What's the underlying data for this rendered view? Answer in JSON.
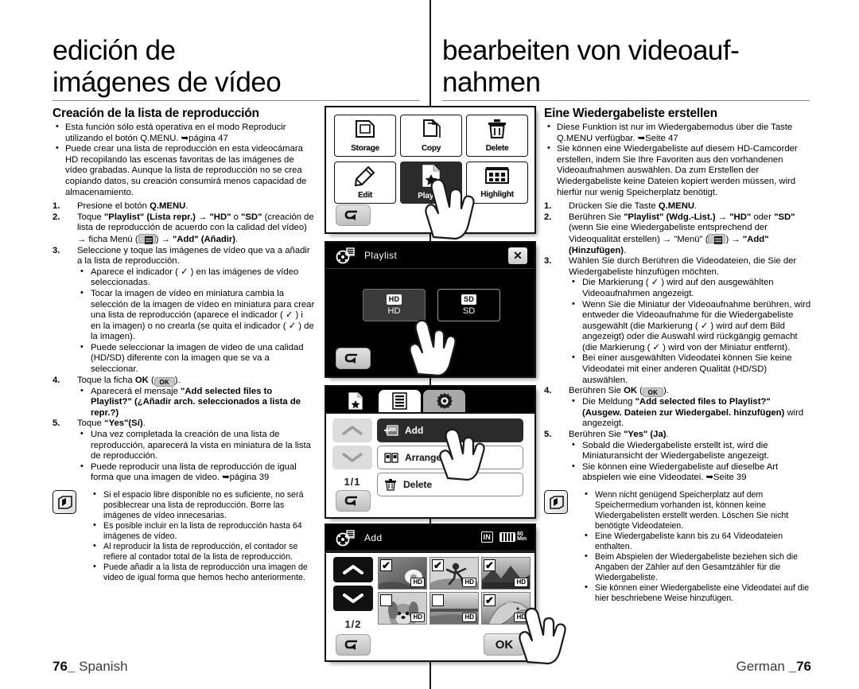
{
  "page": {
    "left_lang_footer": "Spanish",
    "right_lang_footer": "German",
    "page_number": "76",
    "footer_left_num": "76_",
    "footer_right_num": "_76"
  },
  "spanish": {
    "chapter_title": "edición de imágenes de vídeo",
    "section_heading": "Creación de la lista de reproducción",
    "intro_bullets": [
      "Esta función sólo está operativa en el modo Reproducir utilizando el botón Q.MENU. ➥página 47",
      "Puede crear una lista de reproducción en esta videocámara HD recopilando las escenas favoritas de las imágenes de vídeo grabadas. Aunque la lista de reproducción no se crea copiando datos, su creación consumirá menos capacidad de almacenamiento."
    ],
    "steps": [
      {
        "num": "1.",
        "text_html": "Presione el botón <b>Q.MENU</b>.",
        "sub": []
      },
      {
        "num": "2.",
        "text_html": "Toque <b>\"Playlist\" (Lista repr.)</b> → <b>\"HD\"</b> o <b>\"SD\"</b> (creación de lista de reproducción de acuerdo con la calidad del vídeo) → ficha Menú (<span class=\"inline-menu-icon\" data-name=\"menu-tab-icon\"></span>) → <b>\"Add\" (Añadir)</b>.",
        "sub": []
      },
      {
        "num": "3.",
        "text_html": "Seleccione y toque las imágenes de vídeo que va a añadir a la lista de reproducción.",
        "sub": [
          "Aparece el indicador ( ✓ ) en las imágenes de vídeo seleccionadas.",
          "Tocar la imagen de vídeo en miniatura cambia la selección de la imagen de vídeo en miniatura para crear una lista de reproducción (aparece el indicador ( ✓ ) i en la imagen) o no crearla (se quita el indicador ( ✓ ) de la imagen).",
          "Puede seleccionar la imagen de video de una calidad (HD/SD) diferente con la imagen que se va a seleccionar."
        ]
      },
      {
        "num": "4.",
        "text_html": "Toque la ficha <b>OK</b> (<span class=\"inline-ok-icon\" data-name=\"ok-tab-icon\">OK</span>).",
        "sub": [
          "Aparecerá el mensaje <b>\"Add selected files to Playlist?\" (¿Añadir arch. seleccionados a lista de repr.?)</b>"
        ]
      },
      {
        "num": "5.",
        "text_html": "Toque <b>“Yes\"(Sí)</b>.",
        "sub": [
          "Una vez completada la creación de una lista de reproducción, aparecerá la vista en miniatura de la lista de reproducción.",
          "Puede reproducir una lista de reproducción de igual forma que una imagen de video. ➥página 39"
        ]
      }
    ],
    "note_bullets": [
      "Si el espacio libre disponible no es suficiente, no será posiblecrear una lista de reproducción. Borre las imágenes de vídeo innecesarias.",
      "Es posible incluir en la lista de reproducción hasta 64 imágenes de vídeo.",
      "Al reproducir la lista de reproducción, el contador se refiere al contador total de la lista de reproducción.",
      "Puede añadir a la lista de reproducción una imagen de video de igual forma que hemos hecho anteriormente."
    ]
  },
  "german": {
    "chapter_title": "bearbeiten von videoauf-nahmen",
    "section_heading": "Eine Wiedergabeliste erstellen",
    "intro_bullets": [
      "Diese Funktion ist nur im Wiedergabemodus über die Taste Q.MENU verfügbar. ➥Seite 47",
      "Sie können eine Wiedergabeliste auf diesem HD-Camcorder erstellen, indem Sie Ihre Favoriten aus den vorhandenen Videoaufnahmen auswählen. Da zum Erstellen der Wiedergabeliste keine Dateien kopiert werden müssen, wird hierfür nur wenig Speicherplatz benötigt."
    ],
    "steps": [
      {
        "num": "1.",
        "text_html": "Drücken Sie die Taste <b>Q.MENU</b>.",
        "sub": []
      },
      {
        "num": "2.",
        "text_html": "Berühren Sie <b>\"Playlist\" (Wdg.-List.)</b> → <b>\"HD\"</b> oder <b>\"SD\"</b> (wenn Sie eine Wiedergabeliste entsprechend der Videoqualität erstellen) → \"Menü\" (<span class=\"inline-menu-icon\" data-name=\"menu-tab-icon\"></span>) → <b>\"Add\" (Hinzufügen)</b>.",
        "sub": []
      },
      {
        "num": "3.",
        "text_html": "Wählen Sie durch Berühren die Videodateien, die Sie der Wiedergabeliste hinzufügen möchten.",
        "sub": [
          "Die Markierung ( ✓ ) wird auf den ausgewählten Videoaufnahmen angezeigt.",
          "Wenn Sie die Miniatur der Videoaufnahme berühren, wird entweder die Videoaufnahme für die Wiedergabeliste ausgewählt (die Markierung ( ✓ ) wird auf dem Bild angezeigt) oder die Auswahl wird rückgängig gemacht (die Markierung ( ✓ ) wird von der Miniatur entfernt).",
          "Bei einer ausgewählten Videodatei können Sie keine Videodatei mit einer anderen Qualität (HD/SD) auswählen."
        ]
      },
      {
        "num": "4.",
        "text_html": "Berühren Sie <b>OK</b> (<span class=\"inline-ok-icon\" data-name=\"ok-tab-icon\">OK</span>).",
        "sub": [
          "Die Meldung <b>\"Add selected files to Playlist?\" (Ausgew. Dateien zur Wiedergabel. hinzufügen)</b> wird angezeigt."
        ]
      },
      {
        "num": "5.",
        "text_html": "Berühren Sie <b>\"Yes\" (Ja)</b>.",
        "sub": [
          "Sobald die Wiedergabeliste erstellt ist, wird die Miniaturansicht der Wiedergabeliste angezeigt.",
          "Sie können eine Wiedergabeliste auf dieselbe Art abspielen wie eine Videodatei. ➥Seite 39"
        ]
      }
    ],
    "note_bullets": [
      "Wenn nicht genügend Speicherplatz auf dem Speichermedium vorhanden ist, können keine Wiedergabelisten erstellt werden. Löschen Sie nicht benötigte Videodateien.",
      "Eine Wiedergabeliste kann bis zu 64 Videodateien enthalten.",
      "Beim Abspielen der Wiedergabeliste beziehen sich die Angaben der Zähler auf den Gesamtzähler für die Wiedergabeliste.",
      "Sie können einer Wiedergabeliste eine Videodatei auf die hier beschriebene Weise hinzufügen."
    ]
  },
  "screens": {
    "quick_menu": {
      "items": [
        {
          "label": "Storage",
          "icon": "sd-card-icon",
          "selected": false
        },
        {
          "label": "Copy",
          "icon": "copy-pages-icon",
          "selected": false
        },
        {
          "label": "Delete",
          "icon": "trash-icon",
          "selected": false
        },
        {
          "label": "Edit",
          "icon": "pencil-icon",
          "selected": false
        },
        {
          "label": "Playlist",
          "icon": "star-document-icon",
          "selected": true
        },
        {
          "label": "Highlight",
          "icon": "filmstrip-icon",
          "selected": false
        }
      ],
      "back_label": "back-arrow-icon"
    },
    "playlist_quality": {
      "title": "Playlist",
      "close_label": "✕",
      "options": [
        {
          "badge": "HD",
          "label": "HD",
          "selected": true
        },
        {
          "badge": "SD",
          "label": "SD",
          "selected": false
        }
      ]
    },
    "playlist_menu": {
      "tabs": [
        "playlist-star-tab",
        "menu-list-tab",
        "settings-gear-tab"
      ],
      "active_tab_index": 1,
      "page_indicator": "1/1",
      "items": [
        {
          "label": "Add",
          "selected": true
        },
        {
          "label": "Arrange",
          "selected": false
        },
        {
          "label": "Delete",
          "selected": false
        }
      ]
    },
    "add_screen": {
      "title": "Add",
      "storage_indicator": "IN",
      "battery_time": "80",
      "battery_unit": "Min",
      "page_indicator": "1/2",
      "ok_label": "OK",
      "thumbnails": [
        {
          "checked": true,
          "quality": "HD",
          "subject": "flower-thumbnail"
        },
        {
          "checked": true,
          "quality": "HD",
          "subject": "sports-thumbnail"
        },
        {
          "checked": true,
          "quality": "HD",
          "subject": "landscape-thumbnail"
        },
        {
          "checked": false,
          "quality": "HD",
          "subject": "dog-thumbnail"
        },
        {
          "checked": false,
          "quality": "HD",
          "subject": "beach-thumbnail"
        },
        {
          "checked": true,
          "quality": "HD",
          "subject": "dolphin-thumbnail"
        }
      ]
    }
  }
}
